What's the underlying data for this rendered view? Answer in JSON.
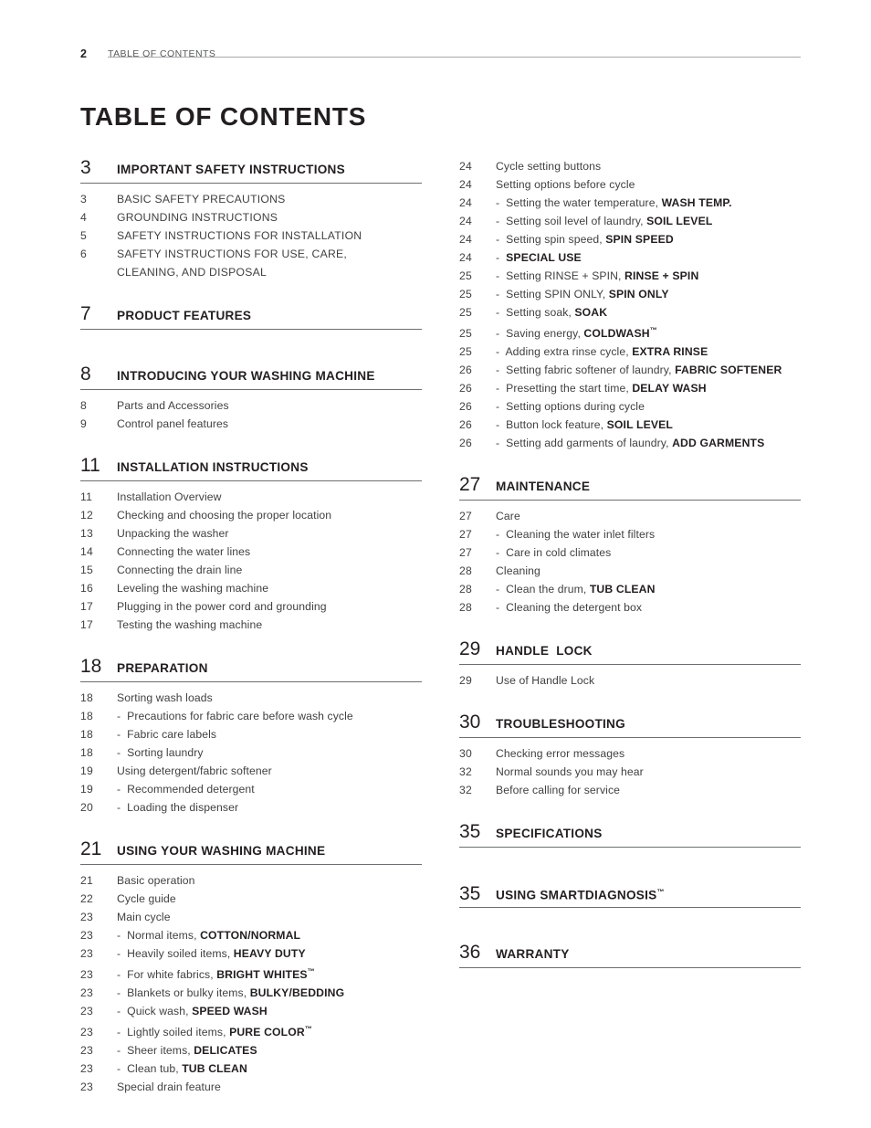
{
  "header": {
    "page_number": "2",
    "running_title": "TABLE OF CONTENTS"
  },
  "title": "TABLE OF CONTENTS",
  "left_column": {
    "sections": [
      {
        "number": "3",
        "title": "IMPORTANT SAFETY INSTRUCTIONS",
        "entries": [
          {
            "page": "3",
            "text": "BASIC SAFETY PRECAUTIONS"
          },
          {
            "page": "4",
            "text": "GROUNDING INSTRUCTIONS"
          },
          {
            "page": "5",
            "text": "SAFETY INSTRUCTIONS FOR INSTALLATION"
          },
          {
            "page": "6",
            "text": "SAFETY INSTRUCTIONS FOR USE, CARE,"
          },
          {
            "page": "",
            "text": "CLEANING, AND DISPOSAL"
          }
        ]
      },
      {
        "number": "7",
        "title": "PRODUCT FEATURES",
        "entries": []
      },
      {
        "number": "8",
        "title": "INTRODUCING YOUR WASHING MACHINE",
        "entries": [
          {
            "page": "8",
            "text": "Parts and Accessories"
          },
          {
            "page": "9",
            "text": "Control panel features"
          }
        ]
      },
      {
        "number": "11",
        "title": "INSTALLATION INSTRUCTIONS",
        "entries": [
          {
            "page": "11",
            "text": "Installation Overview"
          },
          {
            "page": "12",
            "text": "Checking and choosing the proper location"
          },
          {
            "page": "13",
            "text": "Unpacking the washer"
          },
          {
            "page": "14",
            "text": "Connecting the water lines"
          },
          {
            "page": "15",
            "text": "Connecting the drain line"
          },
          {
            "page": "16",
            "text": "Leveling the washing machine"
          },
          {
            "page": "17",
            "text": "Plugging in the power cord and grounding"
          },
          {
            "page": "17",
            "text": "Testing the washing machine"
          }
        ]
      },
      {
        "number": "18",
        "title": "PREPARATION",
        "entries": [
          {
            "page": "18",
            "text": "Sorting wash loads"
          },
          {
            "page": "18",
            "text": "-  Precautions for fabric care before wash cycle"
          },
          {
            "page": "18",
            "text": "-  Fabric care labels"
          },
          {
            "page": "18",
            "text": "-  Sorting laundry"
          },
          {
            "page": "19",
            "text": "Using detergent/fabric softener"
          },
          {
            "page": "19",
            "text": "-  Recommended detergent"
          },
          {
            "page": "20",
            "text": "-  Loading the dispenser"
          }
        ]
      },
      {
        "number": "21",
        "title": "USING YOUR WASHING MACHINE",
        "entries": [
          {
            "page": "21",
            "text": "Basic operation"
          },
          {
            "page": "22",
            "text": "Cycle guide"
          },
          {
            "page": "23",
            "text": "Main cycle"
          },
          {
            "page": "23",
            "text": "-  Normal items, ",
            "bold": "COTTON/NORMAL"
          },
          {
            "page": "23",
            "text": "-  Heavily soiled items, ",
            "bold": "HEAVY DUTY"
          },
          {
            "page": "23",
            "text": "-  For white fabrics, ",
            "bold": "BRIGHT WHITES",
            "tm": true
          },
          {
            "page": "23",
            "text": "-  Blankets or bulky items, ",
            "bold": "BULKY/BEDDING"
          },
          {
            "page": "23",
            "text": "-  Quick wash, ",
            "bold": "SPEED WASH"
          },
          {
            "page": "23",
            "text": "-  Lightly soiled items, ",
            "bold": "PURE COLOR",
            "tm": true
          },
          {
            "page": "23",
            "text": "-  Sheer items, ",
            "bold": "DELICATES"
          },
          {
            "page": "23",
            "text": "-  Clean tub, ",
            "bold": "TUB CLEAN"
          },
          {
            "page": "23",
            "text": "Special drain feature"
          }
        ]
      }
    ]
  },
  "right_column": {
    "continued_entries": [
      {
        "page": "24",
        "text": "Cycle setting buttons"
      },
      {
        "page": "24",
        "text": "Setting options before cycle"
      },
      {
        "page": "24",
        "text": "-  Setting the water temperature, ",
        "bold": "WASH TEMP."
      },
      {
        "page": "24",
        "text": "-  Setting soil level of laundry, ",
        "bold": "SOIL LEVEL"
      },
      {
        "page": "24",
        "text": "-  Setting spin speed, ",
        "bold": "SPIN SPEED"
      },
      {
        "page": "24",
        "text": "-  ",
        "bold": "SPECIAL USE"
      },
      {
        "page": "25",
        "text": "-  Setting RINSE + SPIN, ",
        "bold": "RINSE + SPIN"
      },
      {
        "page": "25",
        "text": "-  Setting SPIN ONLY, ",
        "bold": "SPIN ONLY"
      },
      {
        "page": "25",
        "text": "-  Setting soak, ",
        "bold": "SOAK"
      },
      {
        "page": "25",
        "text": "-  Saving energy, ",
        "bold": "COLDWASH",
        "tm": true
      },
      {
        "page": "25",
        "text": "-  Adding extra rinse cycle, ",
        "bold": "EXTRA RINSE"
      },
      {
        "page": "26",
        "text": "-  Setting fabric softener of laundry, ",
        "bold": "FABRIC SOFTENER"
      },
      {
        "page": "26",
        "text": "-  Presetting the start time, ",
        "bold": "DELAY WASH"
      },
      {
        "page": "26",
        "text": "-  Setting options during cycle"
      },
      {
        "page": "26",
        "text": "-  Button lock feature, ",
        "bold": "SOIL LEVEL"
      },
      {
        "page": "26",
        "text": "-  Setting add garments of laundry, ",
        "bold": "ADD GARMENTS"
      }
    ],
    "sections": [
      {
        "number": "27",
        "title": "MAINTENANCE",
        "entries": [
          {
            "page": "27",
            "text": "Care"
          },
          {
            "page": "27",
            "text": "-  Cleaning the water inlet filters"
          },
          {
            "page": "27",
            "text": "-  Care in cold climates"
          },
          {
            "page": "28",
            "text": "Cleaning"
          },
          {
            "page": "28",
            "text": "-  Clean the drum, ",
            "bold": "TUB CLEAN"
          },
          {
            "page": "28",
            "text": "-  Cleaning the detergent box"
          }
        ]
      },
      {
        "number": "29",
        "title": "HANDLE  LOCK",
        "entries": [
          {
            "page": "29",
            "text": "Use of Handle Lock"
          }
        ]
      },
      {
        "number": "30",
        "title": "TROUBLESHOOTING",
        "entries": [
          {
            "page": "30",
            "text": "Checking error messages"
          },
          {
            "page": "32",
            "text": "Normal sounds you may hear"
          },
          {
            "page": "32",
            "text": "Before calling for service"
          }
        ]
      },
      {
        "number": "35",
        "title": "SPECIFICATIONS",
        "entries": []
      },
      {
        "number": "35",
        "title": "USING SMARTDIAGNOSIS",
        "title_tm": true,
        "entries": []
      },
      {
        "number": "36",
        "title": "WARRANTY",
        "entries": []
      }
    ]
  },
  "colors": {
    "text": "#231f20",
    "muted": "#414042",
    "rule": "#6d6e71",
    "header_rule": "#a7a9ac"
  }
}
